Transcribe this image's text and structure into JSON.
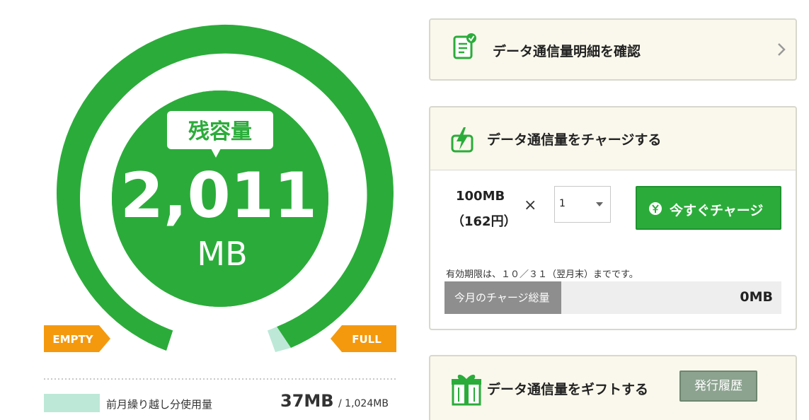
{
  "gauge": {
    "badge_label": "残容量",
    "remaining_value": "2,011",
    "remaining_unit": "MB",
    "empty_label": "EMPTY",
    "full_label": "FULL",
    "remaining_fraction": 0.964,
    "carry_over_fraction": 0.036
  },
  "usage": {
    "legend_label": "前月繰り越し分使用量",
    "used": "37MB",
    "limit": "/ 1,024MB"
  },
  "detail_panel": {
    "title": "データ通信量明細を確認",
    "icon": "document-check-icon",
    "chevron": "chevron-right-icon"
  },
  "charge_panel": {
    "title": "データ通信量をチャージする",
    "icon": "battery-bolt-icon",
    "unit_amount": "100MB",
    "unit_price": "（162円）",
    "times_sign": "×",
    "quantity": "1",
    "button_label": "今すぐチャージ",
    "button_icon": "yen-coin-icon",
    "expiry_note": "有効期限は、１０／３１（翌月末）までです。",
    "total_label": "今月のチャージ総量",
    "total_value": "0MB"
  },
  "gift_panel": {
    "title": "データ通信量をギフトする",
    "icon": "gift-box-icon",
    "history_button": "発行履歴"
  },
  "colors": {
    "green": "#2bac3a",
    "mint": "#bde8d8",
    "orange": "#f4990d",
    "gray_button": "#8ca38f",
    "panel_bg": "#faf8ec"
  }
}
